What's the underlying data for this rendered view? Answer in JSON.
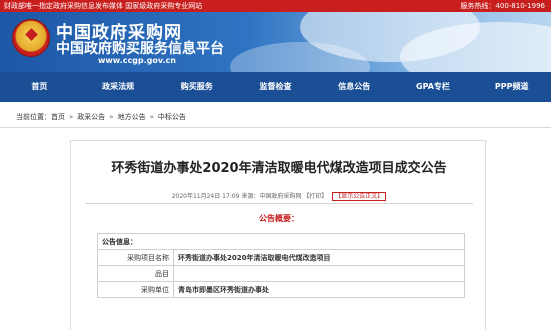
{
  "topbar": {
    "left_text": "财政部唯一指定政府采购信息发布媒体  国家级政府采购专业网站",
    "right_text": "服务热线：400-810-1996"
  },
  "header": {
    "logo_cn": "中国政府采购网",
    "logo_cn2": "中国政府购买服务信息平台",
    "url": "www.ccgp.gov.cn"
  },
  "nav": {
    "items": [
      {
        "label": "首页"
      },
      {
        "label": "政采法规"
      },
      {
        "label": "购买服务"
      },
      {
        "label": "监督检查"
      },
      {
        "label": "信息公告"
      },
      {
        "label": "GPA专栏"
      },
      {
        "label": "PPP频道"
      }
    ]
  },
  "breadcrumb": {
    "prefix": "当前位置：",
    "items": [
      "首页",
      "政采公告",
      "地方公告",
      "中标公告"
    ],
    "separator": "»"
  },
  "article": {
    "title": "环秀街道办事处2020年清洁取暖电代煤改造项目成交公告",
    "datetime": "2020年11月24日 17:09",
    "source_label": "来源：",
    "source": "中国政府采购网",
    "print_label": "【打印】",
    "show_original": "【显示公告正文】",
    "overview_label": "公告概要："
  },
  "info_table": {
    "header": "公告信息：",
    "rows": [
      {
        "label": "采购项目名称",
        "value": "环秀街道办事处2020年清洁取暖电代煤改造项目"
      },
      {
        "label": "品目",
        "value": ""
      },
      {
        "label": "采购单位",
        "value": "青岛市即墨区环秀街道办事处"
      }
    ]
  },
  "colors": {
    "topbar": "#c81e1e",
    "nav": "#1a4f96",
    "accent_red": "#c81e1e"
  }
}
